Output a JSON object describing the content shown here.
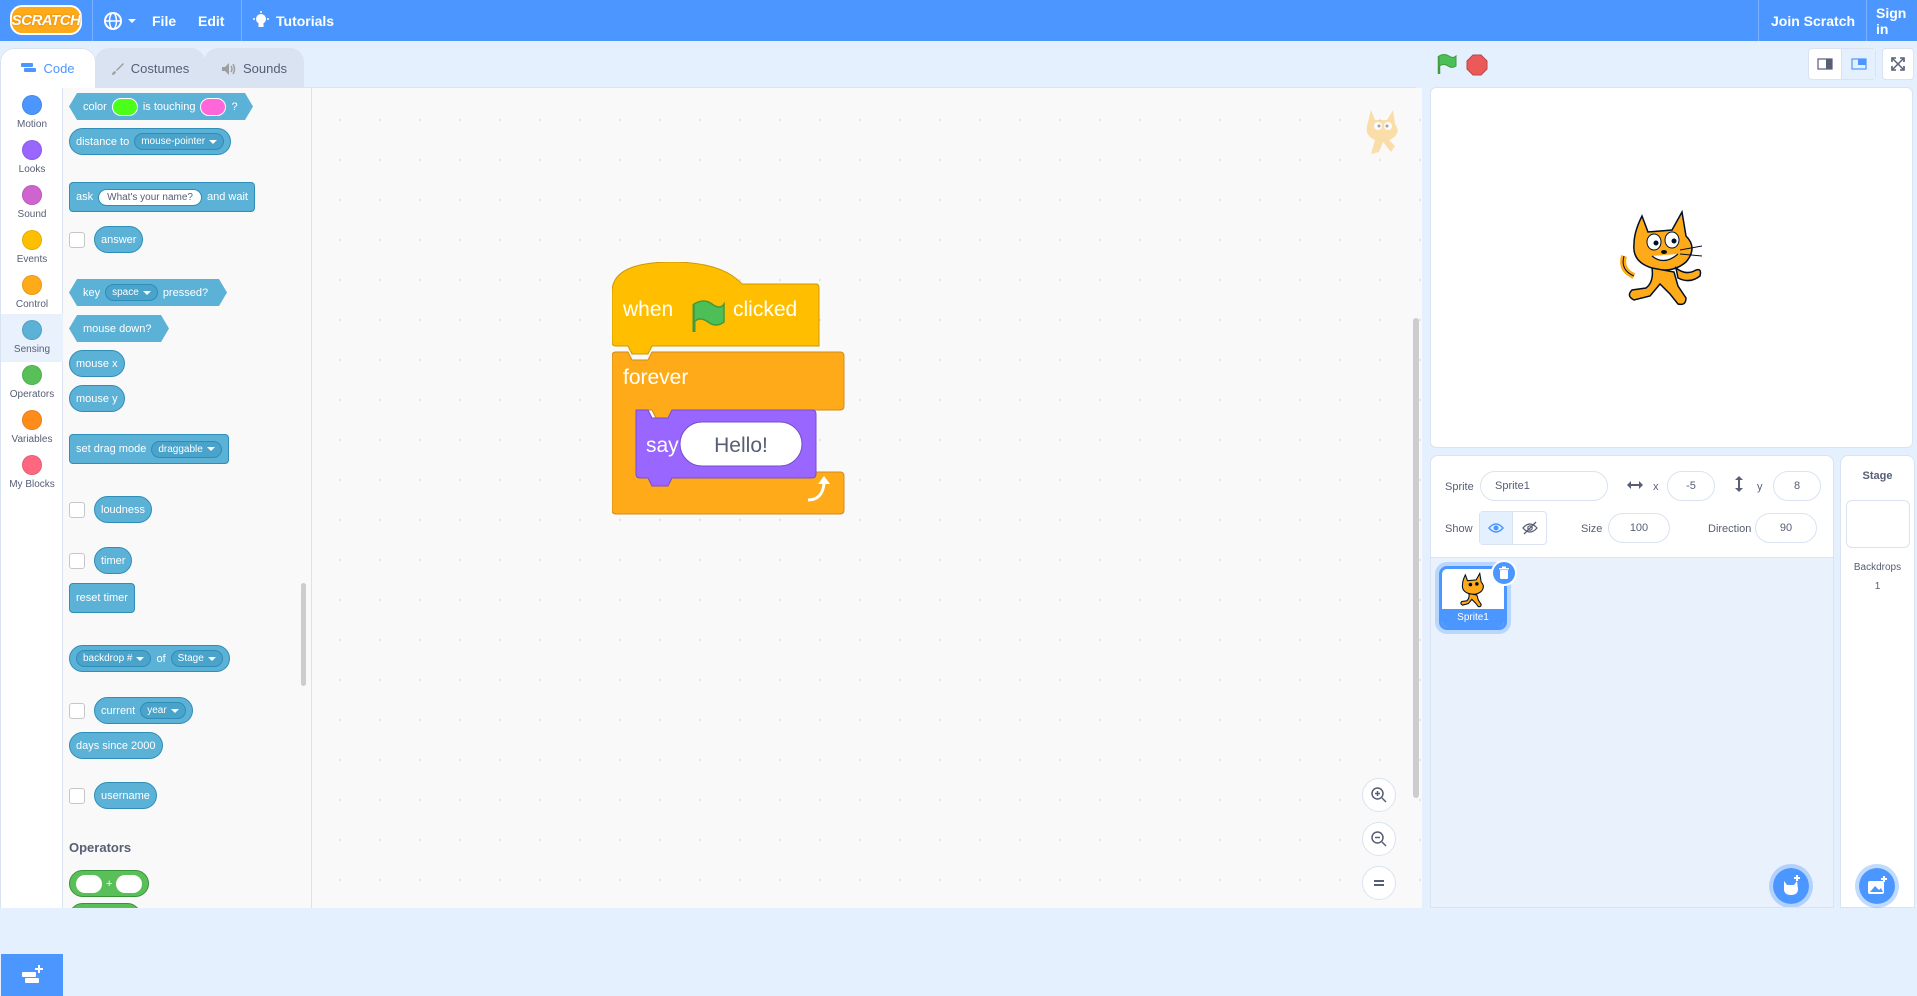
{
  "menubar": {
    "logo": "SCRATCH",
    "file": "File",
    "edit": "Edit",
    "tutorials": "Tutorials",
    "join": "Join Scratch",
    "signin": "Sign in",
    "color": "#4c97ff"
  },
  "tabs": [
    {
      "label": "Code",
      "icon": "code-icon"
    },
    {
      "label": "Costumes",
      "icon": "brush-icon"
    },
    {
      "label": "Sounds",
      "icon": "speaker-icon"
    }
  ],
  "categories": [
    {
      "label": "Motion",
      "color": "#4c97ff"
    },
    {
      "label": "Looks",
      "color": "#9966ff"
    },
    {
      "label": "Sound",
      "color": "#cf63cf"
    },
    {
      "label": "Events",
      "color": "#ffbf00"
    },
    {
      "label": "Control",
      "color": "#ffab19"
    },
    {
      "label": "Sensing",
      "color": "#5cb1d6"
    },
    {
      "label": "Operators",
      "color": "#59c059"
    },
    {
      "label": "Variables",
      "color": "#ff8c1a"
    },
    {
      "label": "My Blocks",
      "color": "#ff6680"
    }
  ],
  "palette": {
    "color_touching": {
      "a": "color",
      "b": "is touching",
      "c": "?"
    },
    "distance": {
      "label": "distance to",
      "menu": "mouse-pointer"
    },
    "ask": {
      "label": "ask",
      "input": "What's your name?",
      "tail": "and wait"
    },
    "answer": "answer",
    "key_pressed": {
      "a": "key",
      "menu": "space",
      "b": "pressed?"
    },
    "mouse_down": "mouse down?",
    "mouse_x": "mouse x",
    "mouse_y": "mouse y",
    "drag_mode": {
      "label": "set drag mode",
      "menu": "draggable"
    },
    "loudness": "loudness",
    "timer": "timer",
    "reset_timer": "reset timer",
    "of": {
      "menu1": "backdrop #",
      "label": "of",
      "menu2": "Stage"
    },
    "current": {
      "label": "current",
      "menu": "year"
    },
    "days_since": "days since 2000",
    "username": "username",
    "operators_heading": "Operators",
    "plus": "+"
  },
  "script": {
    "hat_when": "when",
    "hat_clicked": "clicked",
    "forever": "forever",
    "say": "say",
    "say_value": "Hello!"
  },
  "sprite_info": {
    "sprite_label": "Sprite",
    "sprite_name": "Sprite1",
    "x_label": "x",
    "x_value": "-5",
    "y_label": "y",
    "y_value": "8",
    "show_label": "Show",
    "size_label": "Size",
    "size_value": "100",
    "direction_label": "Direction",
    "direction_value": "90"
  },
  "sprite_list": [
    {
      "name": "Sprite1"
    }
  ],
  "stage_pane": {
    "title": "Stage",
    "backdrops_label": "Backdrops",
    "backdrops_count": "1"
  }
}
